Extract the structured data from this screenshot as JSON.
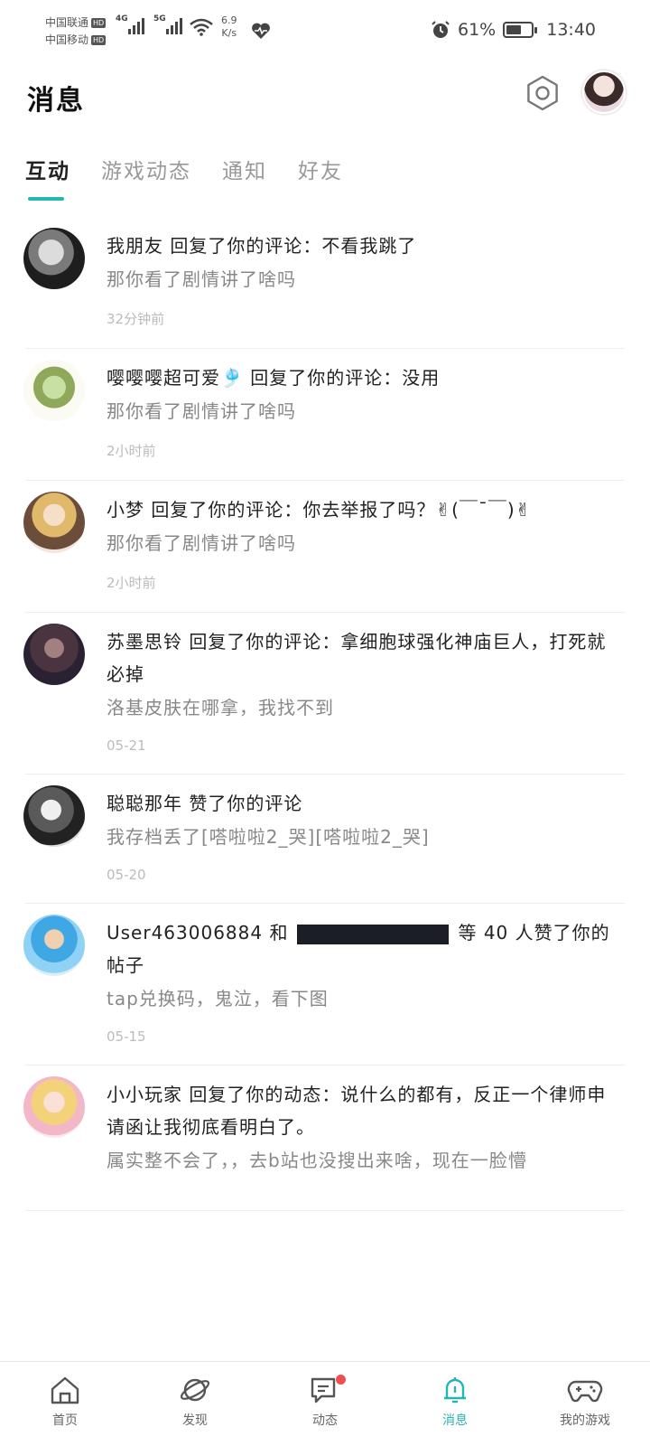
{
  "status_bar": {
    "carrier1": "中国联通",
    "carrier2": "中国移动",
    "hd": "HD",
    "net1": "4G",
    "net2": "5G",
    "speed_value": "6.9",
    "speed_unit": "K/s",
    "battery": "61%",
    "battery_level": 0.61,
    "time": "13:40"
  },
  "header": {
    "title": "消息"
  },
  "tabs": [
    {
      "label": "互动",
      "active": true
    },
    {
      "label": "游戏动态",
      "active": false
    },
    {
      "label": "通知",
      "active": false
    },
    {
      "label": "好友",
      "active": false
    }
  ],
  "messages": [
    {
      "line1": "我朋友 回复了你的评论：不看我跳了",
      "line2": "那你看了剧情讲了啥吗",
      "time": "32分钟前"
    },
    {
      "line1": "嘤嘤嘤超可爱🎐 回复了你的评论：没用",
      "line2": "那你看了剧情讲了啥吗",
      "time": "2小时前"
    },
    {
      "line1": "小梦 回复了你的评论：你去举报了吗？✌(￣ˉ￣)✌",
      "line2": "那你看了剧情讲了啥吗",
      "time": "2小时前"
    },
    {
      "line1": "苏墨思铃 回复了你的评论：拿细胞球强化神庙巨人，打死就必掉",
      "line2": "洛基皮肤在哪拿，我找不到",
      "time": "05-21"
    },
    {
      "line1": "聪聪那年 赞了你的评论",
      "line2": "我存档丢了[嗒啦啦2_哭][嗒啦啦2_哭]",
      "time": "05-20"
    },
    {
      "line1_a": "User463006884 和",
      "line1_b": "等 40 人赞了你的帖子",
      "line2": "tap兑换码，鬼泣，看下图",
      "time": "05-15"
    },
    {
      "line1": "小小玩家 回复了你的动态：说什么的都有，反正一个律师申请函让我彻底看明白了。",
      "line2": "属实整不会了，，去b站也没搜出来啥，现在一脸懵",
      "time": ""
    }
  ],
  "bottom_nav": [
    {
      "label": "首页",
      "icon": "home-icon",
      "active": false
    },
    {
      "label": "发现",
      "icon": "planet-icon",
      "active": false
    },
    {
      "label": "动态",
      "icon": "message-square-icon",
      "active": false,
      "badge": true
    },
    {
      "label": "消息",
      "icon": "bell-icon",
      "active": true
    },
    {
      "label": "我的游戏",
      "icon": "gamepad-icon",
      "active": false
    }
  ],
  "colors": {
    "accent": "#26b6b1",
    "badge": "#ef4e4e"
  }
}
